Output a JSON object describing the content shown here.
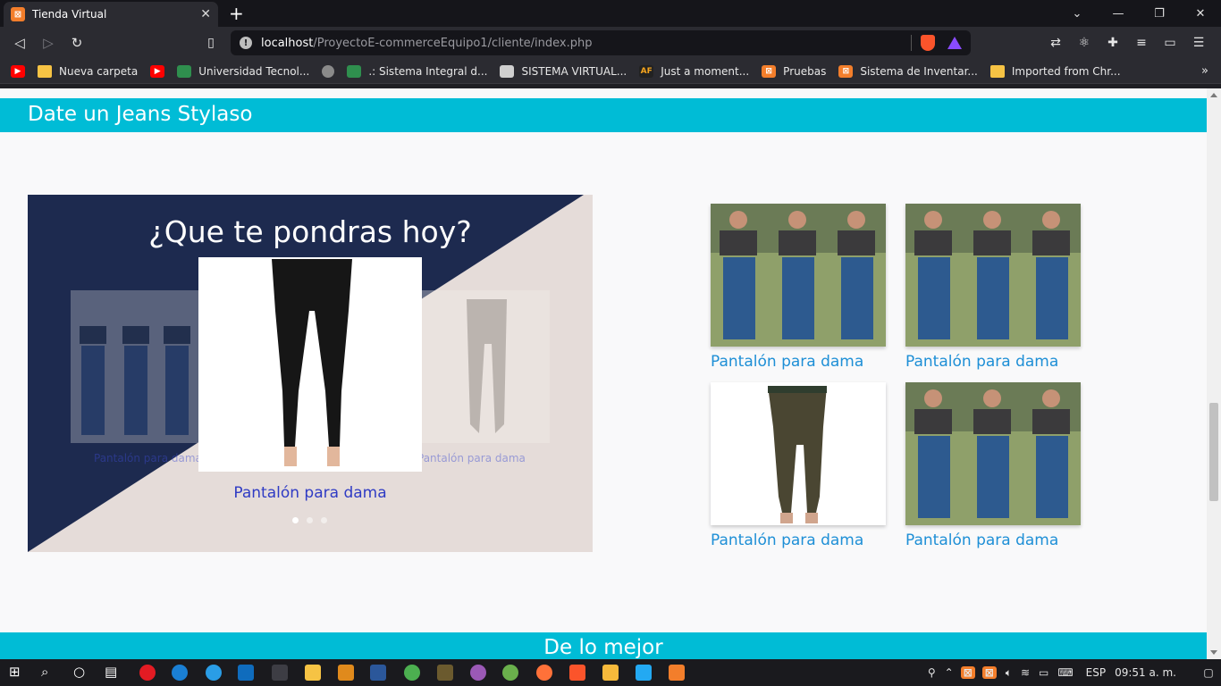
{
  "browser": {
    "tab_title": "Tienda Virtual",
    "tab_close": "✕",
    "new_tab": "+",
    "url_host": "localhost",
    "url_path": "/ProyectoE-commerceEquipo1/cliente/index.php",
    "bookmarks": [
      {
        "label": "",
        "icon": "youtube-icon"
      },
      {
        "label": "Nueva carpeta",
        "icon": "folder-icon"
      },
      {
        "label": "",
        "icon": "youtube-icon"
      },
      {
        "label": "Universidad Tecnol...",
        "icon": "university-icon"
      },
      {
        "label": "",
        "icon": "globe-icon"
      },
      {
        "label": ".: Sistema Integral d...",
        "icon": "university-icon"
      },
      {
        "label": "SISTEMA VIRTUAL...",
        "icon": "system-icon"
      },
      {
        "label": "Just a moment...",
        "icon": "af-icon"
      },
      {
        "label": "Pruebas",
        "icon": "xampp-icon"
      },
      {
        "label": "Sistema de Inventar...",
        "icon": "xampp-icon"
      },
      {
        "label": "Imported from Chr...",
        "icon": "folder-icon"
      }
    ],
    "bookmarks_more": "»"
  },
  "page": {
    "hero_title": "Date un Jeans Stylaso",
    "carousel": {
      "title": "¿Que te pondras hoy?",
      "ghost_left_label": "Pantalón para dama",
      "ghost_right_label": "Pantalón para dama",
      "caption": "Pantalón para dama",
      "slide_count": 3,
      "active_slide": 1
    },
    "products": [
      {
        "label": "Pantalón para dama",
        "image": "model-jeans-collage"
      },
      {
        "label": "Pantalón para dama",
        "image": "model-jeans-collage"
      },
      {
        "label": "Pantalón para dama",
        "image": "olive-jeans"
      },
      {
        "label": "Pantalón para dama",
        "image": "model-jeans-collage"
      }
    ],
    "section_title": "De lo mejor"
  },
  "taskbar": {
    "language": "ESP",
    "time": "09:51 a. m."
  },
  "colors": {
    "accent": "#00bcd6",
    "carousel_dark": "#1d2a4f",
    "carousel_light": "#e5dcd9",
    "product_label": "#1e8fd6",
    "caption": "#2f3bc4"
  }
}
